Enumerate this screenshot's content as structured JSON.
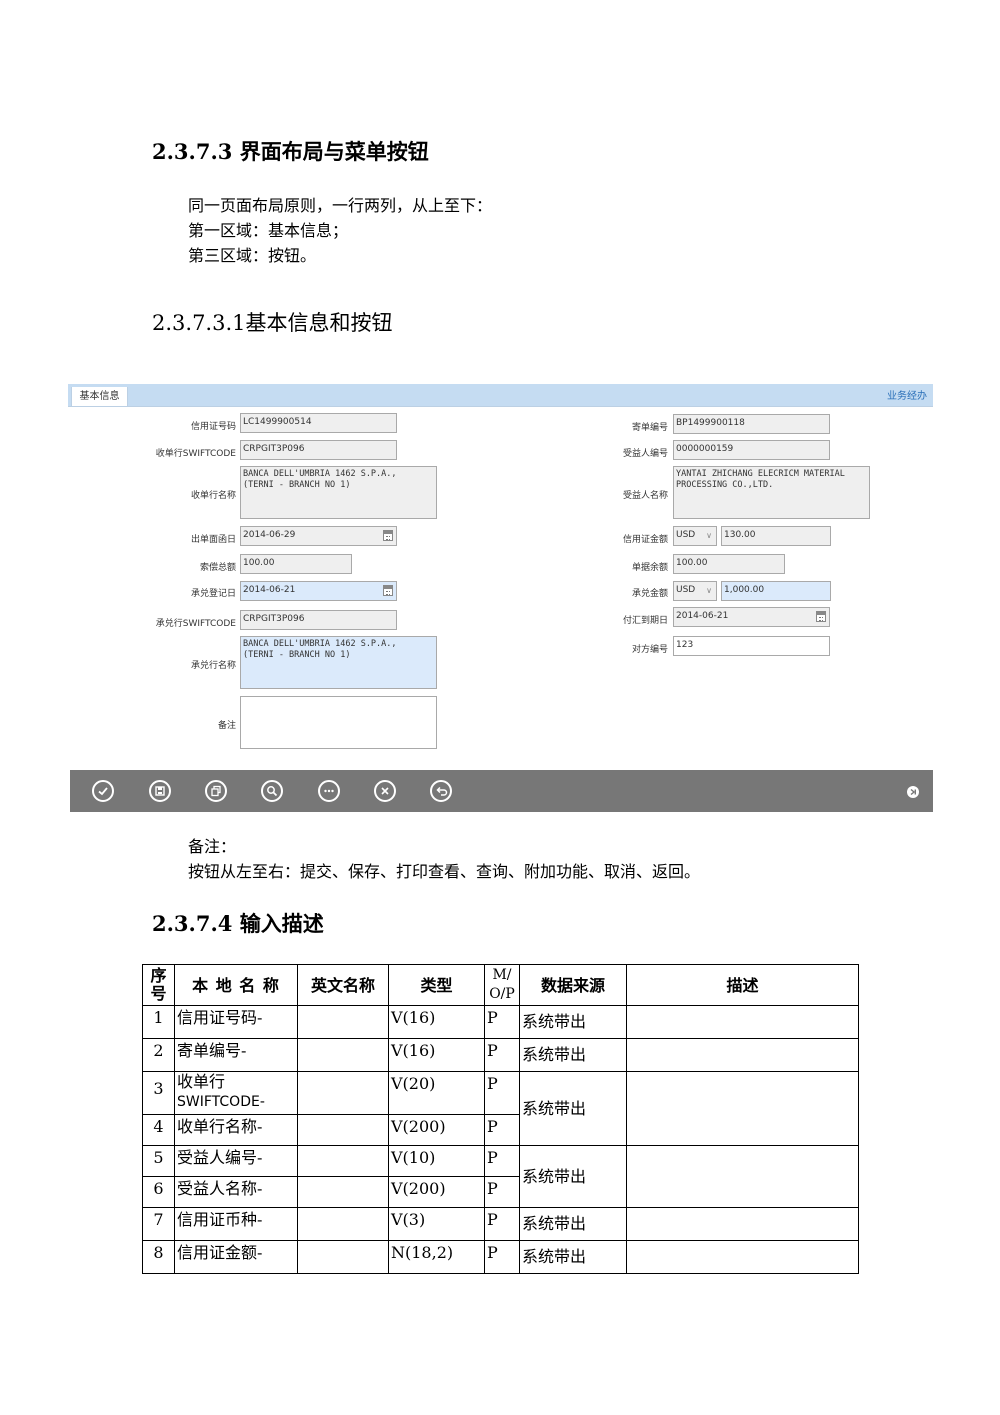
{
  "sections": {
    "h1": "2.3.7.3 界面布局与菜单按钮",
    "intro_lines": [
      "同一页面布局原则，一行两列，从上至下：",
      "第一区域：基本信息；",
      "第三区域：按钮。"
    ],
    "h2": "2.3.7.3.1基本信息和按钮",
    "note_title": "备注：",
    "note_text": "按钮从左至右：提交、保存、打印查看、查询、附加功能、取消、返回。",
    "h3": "2.3.7.4 输入描述"
  },
  "ui": {
    "tab": "基本信息",
    "top_link": "业务经办",
    "left_fields": [
      {
        "label": "信用证号码",
        "value": "LC1499900514"
      },
      {
        "label": "收单行SWIFTCODE",
        "value": "CRPGIT3P096"
      },
      {
        "label": "收单行名称",
        "value": "BANCA DELL'UMBRIA 1462 S.P.A.,\n(TERNI - BRANCH NO 1)"
      },
      {
        "label": "出单面函日",
        "value": "2014-06-29"
      },
      {
        "label": "索偿总额",
        "value": "100.00"
      },
      {
        "label": "承兑登记日",
        "value": "2014-06-21"
      },
      {
        "label": "承兑行SWIFTCODE",
        "value": "CRPGIT3P096"
      },
      {
        "label": "承兑行名称",
        "value": "BANCA DELL'UMBRIA 1462 S.P.A.,\n(TERNI - BRANCH NO 1)"
      },
      {
        "label": "备注",
        "value": ""
      }
    ],
    "right_fields": [
      {
        "label": "寄单编号",
        "value": "BP1499900118"
      },
      {
        "label": "受益人编号",
        "value": "0000000159"
      },
      {
        "label": "受益人名称",
        "value": "YANTAI ZHICHANG ELECRICM MATERIAL\nPROCESSING CO.,LTD."
      },
      {
        "label": "信用证金额",
        "currency": "USD",
        "value": "130.00"
      },
      {
        "label": "单据余额",
        "value": "100.00"
      },
      {
        "label": "承兑金额",
        "currency": "USD",
        "value": "1,000.00"
      },
      {
        "label": "付汇到期日",
        "value": "2014-06-21"
      },
      {
        "label": "对方编号",
        "value": "123"
      }
    ],
    "toolbar_icons": [
      "check-circle-icon",
      "save-circle-icon",
      "print-view-circle-icon",
      "search-circle-icon",
      "more-circle-icon",
      "cancel-circle-icon",
      "back-circle-icon"
    ],
    "end_icon": "skip-end-icon"
  },
  "table": {
    "headers": {
      "seq": "序号",
      "local": "本 地 名 称",
      "english": "英文名称",
      "type": "类型",
      "mop": "M/O/P",
      "source": "数据来源",
      "desc": "描述"
    },
    "rows": [
      {
        "seq": "1",
        "local": "信用证号码-",
        "type": "V(16)",
        "mop": "P",
        "source": "系统带出"
      },
      {
        "seq": "2",
        "local": "寄单编号-",
        "type": "V(16)",
        "mop": "P",
        "source": "系统带出"
      },
      {
        "seq": "3",
        "local": "收单行",
        "local2": "SWIFTCODE-",
        "type": "V(20)",
        "mop": "P",
        "source": "系统带出"
      },
      {
        "seq": "4",
        "local": "收单行名称-",
        "type": "V(200)",
        "mop": "P"
      },
      {
        "seq": "5",
        "local": "受益人编号-",
        "type": "V(10)",
        "mop": "P",
        "source": "系统带出"
      },
      {
        "seq": "6",
        "local": "受益人名称-",
        "type": "V(200)",
        "mop": "P"
      },
      {
        "seq": "7",
        "local": "信用证币种-",
        "type": "V(3)",
        "mop": "P",
        "source": "系统带出"
      },
      {
        "seq": "8",
        "local": "信用证金额-",
        "type": "N(18,2)",
        "mop": "P",
        "source": "系统带出"
      }
    ]
  }
}
